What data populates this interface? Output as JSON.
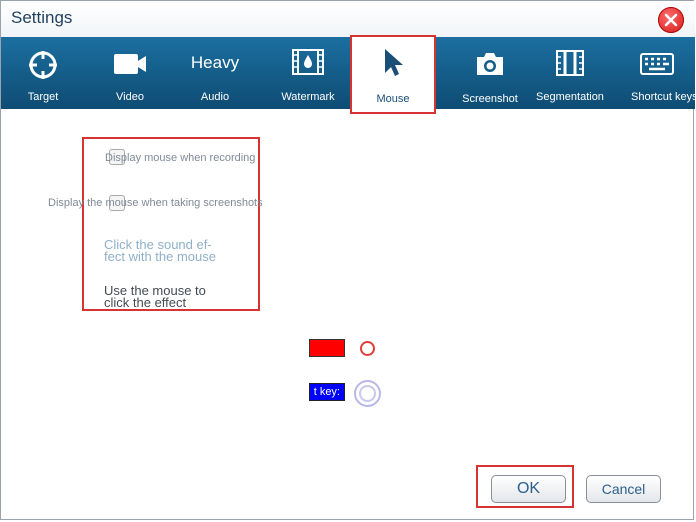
{
  "window": {
    "title": "Settings"
  },
  "toolbar": {
    "tabs": [
      {
        "label": "Target",
        "icon": "crosshair-icon"
      },
      {
        "label": "Video",
        "icon": "video-camera-icon"
      },
      {
        "label": "Audio",
        "heading": "Heavy"
      },
      {
        "label": "Watermark",
        "icon": "watermark-film-icon"
      },
      {
        "label": "Mouse",
        "icon": "mouse-pointer-icon",
        "selected": true
      },
      {
        "label": "Screenshot",
        "icon": "camera-icon"
      },
      {
        "label": "Segmentation",
        "icon": "segmentation-icon"
      },
      {
        "label": "Shortcut keys",
        "icon": "keyboard-icon"
      }
    ]
  },
  "mouse": {
    "display_recording": "Display mouse when recording",
    "display_screenshot": "Display the mouse when taking screenshots",
    "click_sound_line1": "Click the sound ef-",
    "click_sound_line2": "fect with the mouse",
    "click_effect_line1": "Use the mouse to",
    "click_effect_line2": "click the effect",
    "shortcut_key_text": "t key:"
  },
  "colors": {
    "toolbar": "#145d8a",
    "accent_red": "#d63333",
    "swatch_red": "#ff0000",
    "swatch_blue": "#0000ff"
  },
  "buttons": {
    "ok": "OK",
    "cancel": "Cancel"
  }
}
